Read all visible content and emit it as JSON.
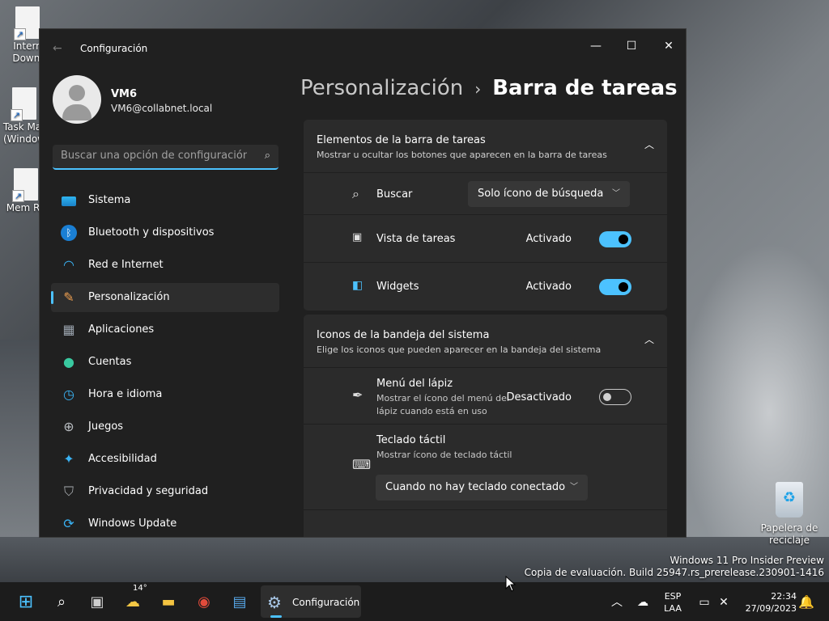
{
  "desktop": {
    "icons": [
      {
        "label_line1": "Intern",
        "label_line2": "Downl"
      },
      {
        "label_line1": "Task Mar",
        "label_line2": "(Window"
      },
      {
        "label_line1": "Mem Re",
        "label_line2": ""
      }
    ],
    "recycle_bin": {
      "line1": "Papelera de",
      "line2": "reciclaje"
    },
    "watermark": {
      "line1": "Windows 11 Pro Insider Preview",
      "line2": "Copia de evaluación. Build 25947.rs_prerelease.230901-1416"
    }
  },
  "window": {
    "title": "Configuración",
    "controls": {
      "minimize": "—",
      "maximize": "☐",
      "close": "✕"
    }
  },
  "profile": {
    "name": "VM6",
    "email": "VM6@collabnet.local"
  },
  "search": {
    "placeholder": "Buscar una opción de configuración"
  },
  "nav": {
    "items": [
      {
        "label": "Sistema",
        "icon": "monitor-icon"
      },
      {
        "label": "Bluetooth y dispositivos",
        "icon": "bluetooth-icon"
      },
      {
        "label": "Red e Internet",
        "icon": "wifi-icon"
      },
      {
        "label": "Personalización",
        "icon": "brush-icon",
        "active": true
      },
      {
        "label": "Aplicaciones",
        "icon": "apps-icon"
      },
      {
        "label": "Cuentas",
        "icon": "person-icon"
      },
      {
        "label": "Hora e idioma",
        "icon": "globe-clock-icon"
      },
      {
        "label": "Juegos",
        "icon": "gamepad-icon"
      },
      {
        "label": "Accesibilidad",
        "icon": "accessibility-icon"
      },
      {
        "label": "Privacidad y seguridad",
        "icon": "shield-icon"
      },
      {
        "label": "Windows Update",
        "icon": "update-icon"
      }
    ]
  },
  "breadcrumb": {
    "parent": "Personalización",
    "separator": "›",
    "current": "Barra de tareas"
  },
  "sections": {
    "taskbar_items": {
      "title": "Elementos de la barra de tareas",
      "subtitle": "Mostrar u ocultar los botones que aparecen en la barra de tareas",
      "rows": {
        "search": {
          "label": "Buscar",
          "dropdown_value": "Solo ícono de búsqueda"
        },
        "task_view": {
          "label": "Vista de tareas",
          "state": "Activado",
          "on": true
        },
        "widgets": {
          "label": "Widgets",
          "state": "Activado",
          "on": true
        }
      }
    },
    "tray_icons": {
      "title": "Iconos de la bandeja del sistema",
      "subtitle": "Elige los iconos que pueden aparecer en la bandeja del sistema",
      "rows": {
        "pen_menu": {
          "label": "Menú del lápiz",
          "desc_line1": "Mostrar el ícono del menú del",
          "desc_line2": "lápiz cuando está en uso",
          "state": "Desactivado",
          "on": false
        },
        "touch_keyboard": {
          "label": "Teclado táctil",
          "desc": "Mostrar ícono de teclado táctil",
          "dropdown_value": "Cuando no hay teclado conectado"
        }
      }
    }
  },
  "taskbar": {
    "weather_temp": "14°",
    "active_app_label": "Configuración",
    "language_line1": "ESP",
    "language_line2": "LAA",
    "time": "22:34",
    "date": "27/09/2023"
  },
  "colors": {
    "accent": "#4cc2ff",
    "window_bg": "#202020",
    "card_bg": "#2b2b2b"
  }
}
